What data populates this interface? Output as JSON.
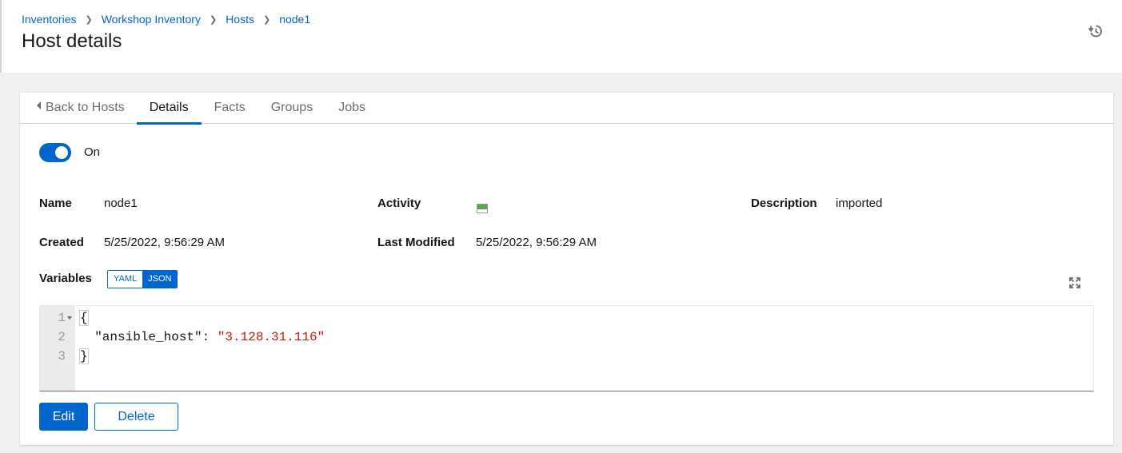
{
  "breadcrumb": {
    "items": [
      "Inventories",
      "Workshop Inventory",
      "Hosts",
      "node1"
    ]
  },
  "header": {
    "title": "Host details",
    "history_icon": "history-icon"
  },
  "tabs": [
    {
      "label": "Back to Hosts",
      "icon": "caret-left-icon"
    },
    {
      "label": "Details"
    },
    {
      "label": "Facts"
    },
    {
      "label": "Groups"
    },
    {
      "label": "Jobs"
    }
  ],
  "toggle": {
    "state": "on",
    "label": "On"
  },
  "details": {
    "name_label": "Name",
    "name_value": "node1",
    "activity_label": "Activity",
    "activity_status_color": "#5ba352",
    "description_label": "Description",
    "description_value": "imported",
    "created_label": "Created",
    "created_value": "5/25/2022, 9:56:29 AM",
    "modified_label": "Last Modified",
    "modified_value": "5/25/2022, 9:56:29 AM"
  },
  "variables": {
    "label": "Variables",
    "modes": [
      "YAML",
      "JSON"
    ],
    "selected_mode": "JSON",
    "line_numbers": [
      "1",
      "2",
      "3"
    ],
    "open_brace": "{",
    "key": "\"ansible_host\"",
    "colon": ": ",
    "value": "\"3.128.31.116\"",
    "close_brace": "}"
  },
  "actions": {
    "edit": "Edit",
    "delete": "Delete"
  },
  "colors": {
    "primary": "#0066cc",
    "string": "#c9190b"
  }
}
